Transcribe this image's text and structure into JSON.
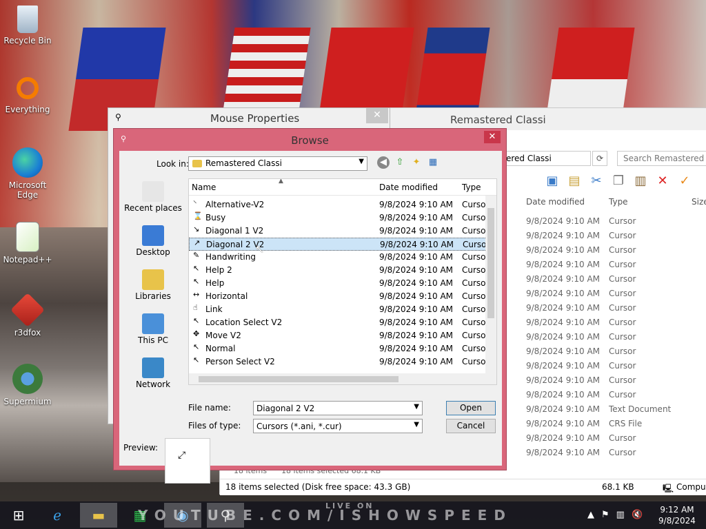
{
  "desktop": {
    "icons": [
      {
        "label": "Recycle Bin",
        "icon": "recycle-bin-icon"
      },
      {
        "label": "Everything",
        "icon": "everything-icon"
      },
      {
        "label": "Microsoft Edge",
        "icon": "edge-icon"
      },
      {
        "label": "Notepad++",
        "icon": "notepad-plus-plus-icon"
      },
      {
        "label": "r3dfox",
        "icon": "r3dfox-icon"
      },
      {
        "label": "Supermium",
        "icon": "supermium-icon"
      }
    ]
  },
  "explorer": {
    "title": "Remastered Classi",
    "address": "ered Classi",
    "search_placeholder": "Search Remastered Cla",
    "columns": {
      "date": "Date modified",
      "type": "Type",
      "size": "Size"
    },
    "rows": [
      {
        "date": "9/8/2024 9:10 AM",
        "type": "Cursor"
      },
      {
        "date": "9/8/2024 9:10 AM",
        "type": "Cursor"
      },
      {
        "date": "9/8/2024 9:10 AM",
        "type": "Cursor"
      },
      {
        "date": "9/8/2024 9:10 AM",
        "type": "Cursor"
      },
      {
        "date": "9/8/2024 9:10 AM",
        "type": "Cursor"
      },
      {
        "date": "9/8/2024 9:10 AM",
        "type": "Cursor"
      },
      {
        "date": "9/8/2024 9:10 AM",
        "type": "Cursor"
      },
      {
        "date": "9/8/2024 9:10 AM",
        "type": "Cursor"
      },
      {
        "date": "9/8/2024 9:10 AM",
        "type": "Cursor"
      },
      {
        "date": "9/8/2024 9:10 AM",
        "type": "Cursor"
      },
      {
        "date": "9/8/2024 9:10 AM",
        "type": "Cursor"
      },
      {
        "date": "9/8/2024 9:10 AM",
        "type": "Cursor"
      },
      {
        "date": "9/8/2024 9:10 AM",
        "type": "Cursor"
      },
      {
        "date": "9/8/2024 9:10 AM",
        "type": "Text Document"
      },
      {
        "date": "9/8/2024 9:10 AM",
        "type": "CRS File"
      },
      {
        "date": "9/8/2024 9:10 AM",
        "type": "Cursor"
      },
      {
        "date": "9/8/2024 9:10 AM",
        "type": "Cursor"
      }
    ],
    "status_items": "18 items",
    "status_selected": "18 items selected  68.1 KB",
    "status_bar": "18 items selected (Disk free space: 43.3 GB)",
    "status_size": "68.1 KB",
    "status_computer": "Comput"
  },
  "mouse_properties": {
    "title": "Mouse Properties"
  },
  "browse": {
    "title": "Browse",
    "look_in_label": "Look in:",
    "look_in_value": "Remastered Classi",
    "places": [
      {
        "label": "Recent places",
        "icon": "recent-places-icon"
      },
      {
        "label": "Desktop",
        "icon": "desktop-icon"
      },
      {
        "label": "Libraries",
        "icon": "libraries-icon"
      },
      {
        "label": "This PC",
        "icon": "this-pc-icon"
      },
      {
        "label": "Network",
        "icon": "network-icon"
      }
    ],
    "columns": {
      "name": "Name",
      "date": "Date modified",
      "type": "Type"
    },
    "files": [
      {
        "name": "Alternative-V2",
        "date": "9/8/2024 9:10 AM",
        "type": "Cursor",
        "glyph": "⸌"
      },
      {
        "name": "Busy",
        "date": "9/8/2024 9:10 AM",
        "type": "Cursor",
        "glyph": "⌛"
      },
      {
        "name": "Diagonal 1 V2",
        "date": "9/8/2024 9:10 AM",
        "type": "Cursor",
        "glyph": "↘"
      },
      {
        "name": "Diagonal 2 V2",
        "date": "9/8/2024 9:10 AM",
        "type": "Cursor",
        "glyph": "↗",
        "selected": true
      },
      {
        "name": "Handwriting",
        "date": "9/8/2024 9:10 AM",
        "type": "Cursor",
        "glyph": "✎"
      },
      {
        "name": "Help 2",
        "date": "9/8/2024 9:10 AM",
        "type": "Cursor",
        "glyph": "↖"
      },
      {
        "name": "Help",
        "date": "9/8/2024 9:10 AM",
        "type": "Cursor",
        "glyph": "↖"
      },
      {
        "name": "Horizontal",
        "date": "9/8/2024 9:10 AM",
        "type": "Cursor",
        "glyph": "↔"
      },
      {
        "name": "Link",
        "date": "9/8/2024 9:10 AM",
        "type": "Cursor",
        "glyph": "☝"
      },
      {
        "name": "Location Select V2",
        "date": "9/8/2024 9:10 AM",
        "type": "Cursor",
        "glyph": "↖"
      },
      {
        "name": "Move V2",
        "date": "9/8/2024 9:10 AM",
        "type": "Cursor",
        "glyph": "✥"
      },
      {
        "name": "Normal",
        "date": "9/8/2024 9:10 AM",
        "type": "Cursor",
        "glyph": "↖"
      },
      {
        "name": "Person Select V2",
        "date": "9/8/2024 9:10 AM",
        "type": "Cursor",
        "glyph": "↖"
      }
    ],
    "file_name_label": "File name:",
    "file_name_value": "Diagonal 2 V2",
    "files_of_type_label": "Files of type:",
    "files_of_type_value": "Cursors (*.ani, *.cur)",
    "open_label": "Open",
    "cancel_label": "Cancel",
    "preview_label": "Preview:"
  },
  "taskbar": {
    "watermark": "YOUTUBE.COM/ISHOWSPEED",
    "watermark_live": "LIVE ON",
    "time": "9:12 AM",
    "date": "9/8/2024"
  }
}
